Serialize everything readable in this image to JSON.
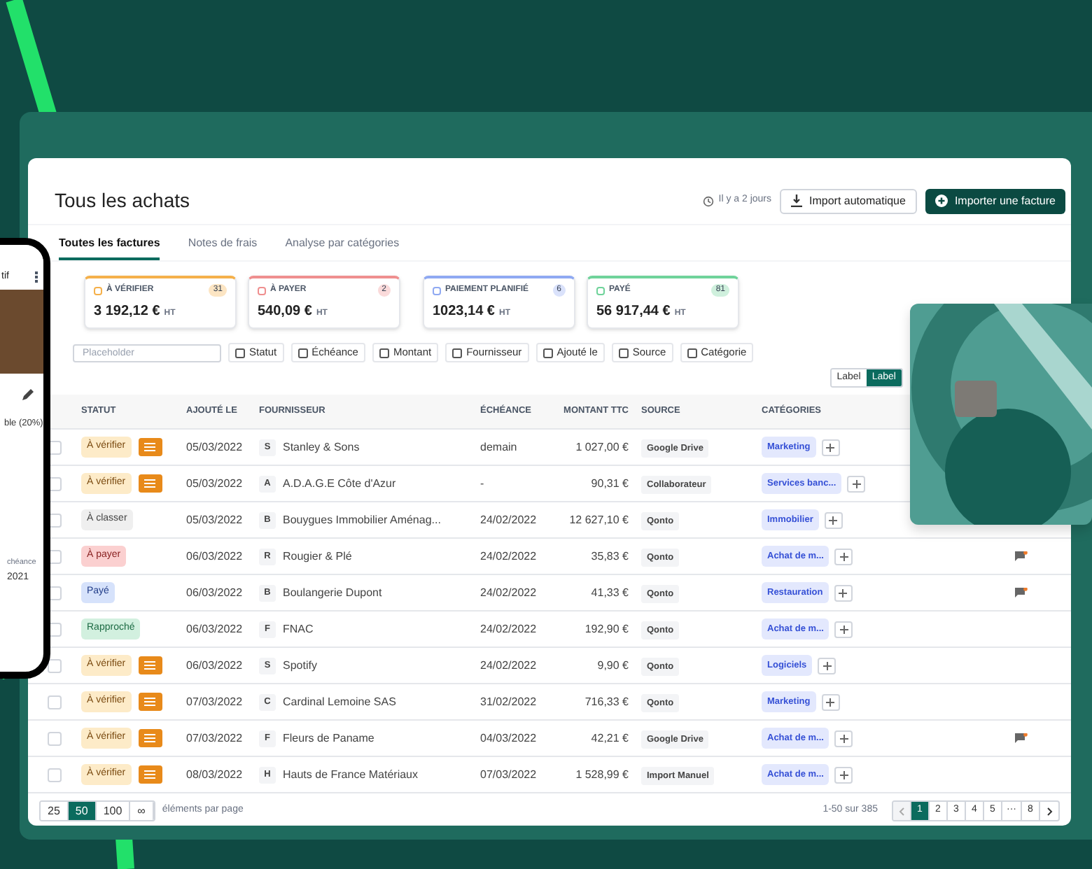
{
  "header": {
    "title": "Tous les achats",
    "sync_time": "Il y a 2 jours",
    "buttons": [
      {
        "label": "Import automatique",
        "kind": "secondary"
      },
      {
        "label": "Importer une facture",
        "kind": "primary"
      }
    ]
  },
  "tabs": [
    {
      "label": "Toutes les factures",
      "selected": true
    },
    {
      "label": "Notes de frais",
      "selected": false
    },
    {
      "label": "Analyse par catégories",
      "selected": false
    }
  ],
  "kpis": [
    {
      "label": "À VÉRIFIER",
      "count": "31",
      "amount": "3 192,12 €",
      "unit": "HT",
      "color": "#f5b04a"
    },
    {
      "label": "À PAYER",
      "count": "2",
      "amount": "540,09 €",
      "unit": "HT",
      "color": "#ef8f8f"
    },
    {
      "label": "PAIEMENT PLANIFIÉ",
      "count": "6",
      "amount": "1023,14 €",
      "unit": "HT",
      "color": "#8fa9f2"
    },
    {
      "label": "PAYÉ",
      "count": "81",
      "amount": "56 917,44 €",
      "unit": "HT",
      "color": "#6fd39a"
    }
  ],
  "search": {
    "placeholder": "Placeholder"
  },
  "filters": [
    "Statut",
    "Échéance",
    "Montant",
    "Fournisseur",
    "Ajouté le",
    "Source",
    "Catégorie"
  ],
  "toggle": [
    {
      "label": "Label",
      "selected": false
    },
    {
      "label": "Label",
      "selected": true
    }
  ],
  "table": {
    "columns": [
      "STATUT",
      "AJOUTÉ LE",
      "FOURNISSEUR",
      "ÉCHÉANCE",
      "MONTANT TTC",
      "SOURCE",
      "CATÉGORIES"
    ],
    "rows": [
      {
        "checked": false,
        "status": "À vérifier",
        "kind": "verify",
        "document": true,
        "added": "05/03/2022",
        "initial": "S",
        "supplier": "Stanley & Sons",
        "due": "demain",
        "amount": "1 027,00 €",
        "source": "Google Drive",
        "category": "Marketing",
        "comment": false
      },
      {
        "checked": false,
        "status": "À vérifier",
        "kind": "verify",
        "document": true,
        "added": "05/03/2022",
        "initial": "A",
        "supplier": "A.D.A.G.E Côte d'Azur",
        "due": "-",
        "amount": "90,31 €",
        "source": "Collaborateur",
        "category": "Services banc...",
        "comment": false
      },
      {
        "checked": false,
        "status": "À classer",
        "kind": "classify",
        "document": false,
        "added": "05/03/2022",
        "initial": "B",
        "supplier": "Bouygues Immobilier Aménag...",
        "due": "24/02/2022",
        "amount": "12 627,10 €",
        "source": "Qonto",
        "category": "Immobilier",
        "comment": false
      },
      {
        "checked": false,
        "status": "À payer",
        "kind": "pay",
        "document": false,
        "added": "06/03/2022",
        "initial": "R",
        "supplier": "Rougier & Plé",
        "due": "24/02/2022",
        "amount": "35,83 €",
        "source": "Qonto",
        "category": "Achat de m...",
        "comment": true
      },
      {
        "checked": false,
        "status": "Payé",
        "kind": "paid",
        "document": false,
        "added": "06/03/2022",
        "initial": "B",
        "supplier": "Boulangerie Dupont",
        "due": "24/02/2022",
        "amount": "41,33 €",
        "source": "Qonto",
        "category": "Restauration",
        "comment": true
      },
      {
        "checked": false,
        "status": "Rapproché",
        "kind": "matched",
        "document": false,
        "added": "06/03/2022",
        "initial": "F",
        "supplier": "FNAC",
        "due": "24/02/2022",
        "amount": "192,90 €",
        "source": "Qonto",
        "category": "Achat de m...",
        "comment": false
      },
      {
        "checked": false,
        "status": "À vérifier",
        "kind": "verify",
        "document": true,
        "added": "06/03/2022",
        "initial": "S",
        "supplier": "Spotify",
        "due": "24/02/2022",
        "amount": "9,90 €",
        "source": "Qonto",
        "category": "Logiciels",
        "comment": false
      },
      {
        "checked": false,
        "status": "À vérifier",
        "kind": "verify",
        "document": true,
        "added": "07/03/2022",
        "initial": "C",
        "supplier": "Cardinal Lemoine SAS",
        "due": "31/02/2022",
        "amount": "716,33 €",
        "source": "Qonto",
        "category": "Marketing",
        "comment": false
      },
      {
        "checked": false,
        "status": "À vérifier",
        "kind": "verify",
        "document": true,
        "added": "07/03/2022",
        "initial": "F",
        "supplier": "Fleurs de Paname",
        "due": "04/03/2022",
        "amount": "42,21 €",
        "source": "Google Drive",
        "category": "Achat de m...",
        "comment": true
      },
      {
        "checked": false,
        "status": "À vérifier",
        "kind": "verify",
        "document": true,
        "added": "08/03/2022",
        "initial": "H",
        "supplier": "Hauts de France Matériaux",
        "due": "07/03/2022",
        "amount": "1 528,99 €",
        "source": "Import Manuel",
        "category": "Achat de m...",
        "comment": false
      }
    ]
  },
  "page_sizes": [
    {
      "label": "25",
      "selected": false
    },
    {
      "label": "50",
      "selected": true
    },
    {
      "label": "100",
      "selected": false
    },
    {
      "label": "∞",
      "selected": false
    }
  ],
  "page_size_label": "éléments par page",
  "range": "1-50 sur 385",
  "pages": [
    {
      "label": "1",
      "selected": true
    },
    {
      "label": "2",
      "selected": false
    },
    {
      "label": "3",
      "selected": false
    },
    {
      "label": "4",
      "selected": false
    },
    {
      "label": "5",
      "selected": false
    },
    {
      "label": "···",
      "selected": false
    },
    {
      "label": "8",
      "selected": false
    }
  ],
  "phone": {
    "title": "tif",
    "line": "ble (20%)",
    "label": "chéance",
    "value": "2021"
  }
}
